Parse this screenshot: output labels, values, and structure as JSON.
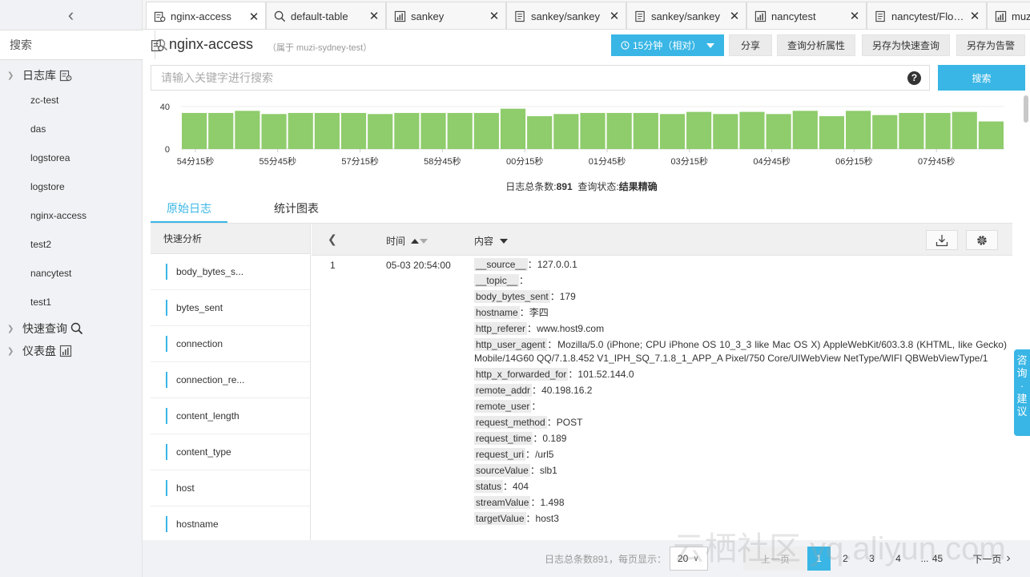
{
  "sidebar": {
    "search_placeholder": "搜索",
    "logstore_group": "日志库",
    "logstores": [
      "zc-test",
      "das",
      "logstorea",
      "logstore",
      "nginx-access",
      "test2",
      "nancytest",
      "test1"
    ],
    "saved_search_group": "快速查询",
    "dashboard_group": "仪表盘"
  },
  "tabs": [
    {
      "label": "nginx-access",
      "icon": "logstore-icon",
      "active": true
    },
    {
      "label": "default-table",
      "icon": "search-icon",
      "active": false
    },
    {
      "label": "sankey",
      "icon": "chart-icon",
      "active": false
    },
    {
      "label": "sankey/sankey",
      "icon": "document-icon",
      "active": false
    },
    {
      "label": "sankey/sankey",
      "icon": "document-icon",
      "active": false
    },
    {
      "label": "nancytest",
      "icon": "chart-icon",
      "active": false
    },
    {
      "label": "nancytest/Flow...",
      "icon": "document-icon",
      "active": false
    },
    {
      "label": "muz",
      "icon": "chart-icon",
      "active": false
    }
  ],
  "header": {
    "title": "nginx-access",
    "subtitle": "（属于 muzi-sydney-test）",
    "time_range": "15分钟（相对）",
    "share": "分享",
    "query_props": "查询分析属性",
    "save_search": "另存为快速查询",
    "save_alert": "另存为告警"
  },
  "query": {
    "placeholder": "请输入关键字进行搜索",
    "help": "?",
    "search_button": "搜索"
  },
  "chart_data": {
    "type": "bar",
    "ylim": [
      0,
      40
    ],
    "yticks": [
      "40",
      "0"
    ],
    "values": [
      34,
      34,
      36,
      33,
      34,
      34,
      34,
      33,
      34,
      34,
      34,
      34,
      38,
      31,
      33,
      34,
      34,
      34,
      33,
      35,
      33,
      35,
      33,
      36,
      31,
      36,
      32,
      34,
      34,
      35,
      26
    ],
    "xticks": [
      "54分15秒",
      "55分45秒",
      "57分15秒",
      "58分45秒",
      "00分15秒",
      "01分45秒",
      "03分15秒",
      "04分45秒",
      "06分15秒",
      "07分45秒"
    ],
    "bar_color": "#8fcc6c"
  },
  "summary": {
    "total_label": "日志总条数:",
    "total": "891",
    "status_label": "查询状态:",
    "status": "结果精确"
  },
  "subtabs": {
    "raw": "原始日志",
    "chart": "统计图表"
  },
  "quick_analysis": {
    "title": "快速分析",
    "fields": [
      "body_bytes_s...",
      "bytes_sent",
      "connection",
      "connection_re...",
      "content_length",
      "content_type",
      "host",
      "hostname"
    ]
  },
  "log_table": {
    "time_header": "时间",
    "content_header": "内容",
    "row": {
      "index": "1",
      "time": "05-03 20:54:00",
      "fields": [
        {
          "key": "__source__",
          "value": "127.0.0.1"
        },
        {
          "key": "__topic__",
          "value": ""
        },
        {
          "key": "body_bytes_sent",
          "value": "179"
        },
        {
          "key": "hostname",
          "value": "李四"
        },
        {
          "key": "http_referer",
          "value": "www.host9.com"
        },
        {
          "key": "http_user_agent",
          "value": "Mozilla/5.0 (iPhone; CPU iPhone OS 10_3_3 like Mac OS X) AppleWebKit/603.3.8 (KHTML, like Gecko) Mobile/14G60 QQ/7.1.8.452 V1_IPH_SQ_7.1.8_1_APP_A Pixel/750 Core/UIWebView NetType/WIFI QBWebViewType/1"
        },
        {
          "key": "http_x_forwarded_for",
          "value": "101.52.144.0"
        },
        {
          "key": "remote_addr",
          "value": "40.198.16.2"
        },
        {
          "key": "remote_user",
          "value": ""
        },
        {
          "key": "request_method",
          "value": "POST"
        },
        {
          "key": "request_time",
          "value": "0.189"
        },
        {
          "key": "request_uri",
          "value": "/url5"
        },
        {
          "key": "sourceValue",
          "value": "slb1"
        },
        {
          "key": "status",
          "value": "404"
        },
        {
          "key": "streamValue",
          "value": "1.498"
        },
        {
          "key": "targetValue",
          "value": "host3"
        }
      ]
    }
  },
  "feedback": [
    "咨",
    "询",
    "·",
    "建",
    "议"
  ],
  "pagination": {
    "total_text": "日志总条数891，每页显示：",
    "page_size": "20",
    "prev": "上一页",
    "pages": [
      "1",
      "2",
      "3",
      "4",
      "...",
      "45"
    ],
    "current": "1",
    "next": "下一页"
  },
  "watermark": "云栖社区 yq.aliyun.com"
}
